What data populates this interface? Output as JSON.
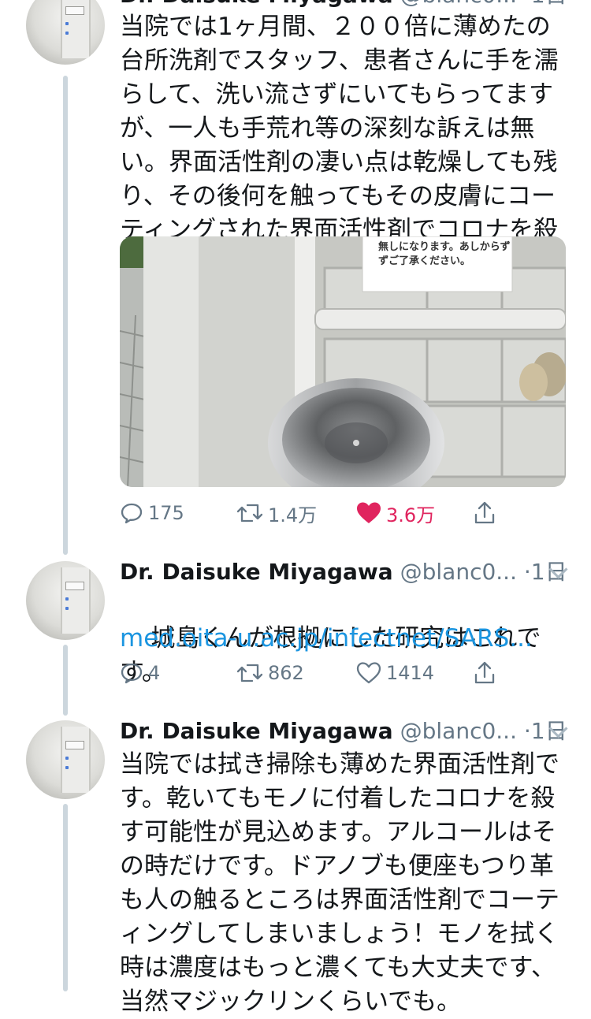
{
  "colors": {
    "accent_link": "#1b95e0",
    "like_active": "#e0245e",
    "secondary_text": "#657786",
    "thread_line": "#ccd6dd"
  },
  "tweets": [
    {
      "name": "Dr. Daisuke Miyagawa",
      "handle": "@blanc0...",
      "time": "1日",
      "text": "当院では1ヶ月間、２００倍に薄めたの台所洗剤でスタッフ、患者さんに手を濡らして、洗い流さずにいてもらってますが、一人も手荒れ等の深刻な訴えは無い。界面活性剤の凄い点は乾燥しても残り、その後何を触ってもその皮膚にコーティングされた界面活性剤でコロナを殺す可能性が高い。",
      "image": {
        "notice_line1": "無しになります。あしからず",
        "notice_line2": "ずご了承ください。"
      },
      "actions": {
        "reply_count": "175",
        "retweet_count": "1.4万",
        "like_count": "3.6万",
        "liked": true
      }
    },
    {
      "name": "Dr. Daisuke Miyagawa",
      "handle": "@blanc0...",
      "time": "1日",
      "text": "城島くんが根拠にした研究はこれです。",
      "link": "med.oita-u.ac.jp/infectnet/SARS...",
      "actions": {
        "reply_count": "4",
        "retweet_count": "862",
        "like_count": "1414",
        "liked": false
      }
    },
    {
      "name": "Dr. Daisuke Miyagawa",
      "handle": "@blanc0...",
      "time": "1日",
      "text": "当院では拭き掃除も薄めた界面活性剤です。乾いてもモノに付着したコロナを殺す可能性が見込めます。アルコールはその時だけです。ドアノブも便座もつり革も人の触るところは界面活性剤でコーティングしてしまいましょう！モノを拭く時は濃度はもっと濃くても大丈夫です、当然マジックリンくらいでも。"
    }
  ],
  "separator": "·"
}
